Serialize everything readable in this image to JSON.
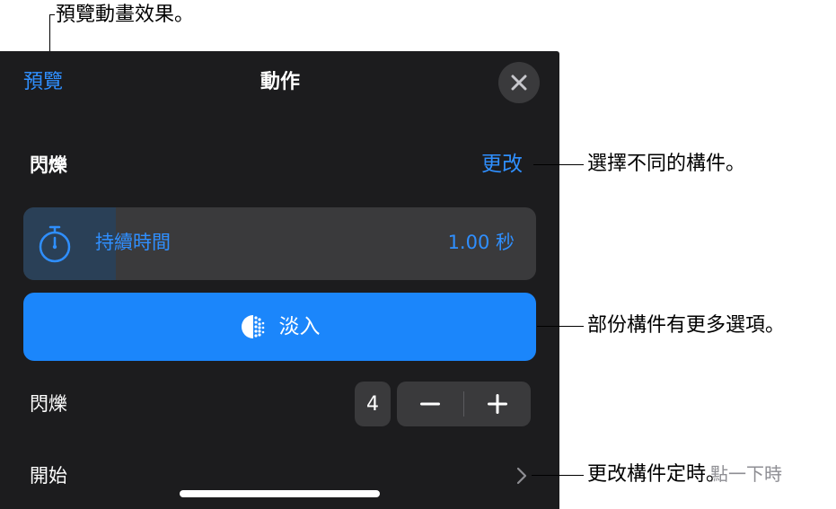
{
  "callouts": {
    "preview": "預覽動畫效果。",
    "change": "選擇不同的構件。",
    "options": "部份構件有更多選項。",
    "timing": "更改構件定時。"
  },
  "header": {
    "preview_label": "預覽",
    "title": "動作",
    "close_icon": "close-icon"
  },
  "action": {
    "name": "閃爍",
    "change_label": "更改"
  },
  "duration": {
    "label": "持續時間",
    "value": "1.00 秒",
    "icon": "stopwatch-icon",
    "level": 0.18
  },
  "effect": {
    "label": "淡入",
    "icon": "fade-icon"
  },
  "flash_row": {
    "label": "閃爍",
    "count": "4",
    "minus_icon": "minus-icon",
    "plus_icon": "plus-icon"
  },
  "start_row": {
    "label": "開始",
    "value": "點一下時",
    "chevron_icon": "chevron-right-icon"
  },
  "colors": {
    "panel": "#1c1c1e",
    "accent": "#2f8fff",
    "button": "#1b86fb",
    "control": "#3a3a3c"
  }
}
